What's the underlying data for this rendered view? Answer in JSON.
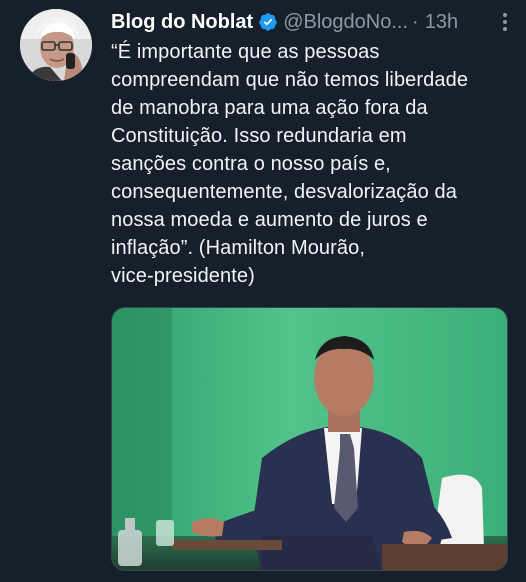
{
  "tweet": {
    "display_name": "Blog do Noblat",
    "handle": "@BlogdoNo...",
    "separator": "·",
    "timestamp": "13h",
    "text": "“É importante que as pessoas\ncompreendam que não temos liberdade\nde manobra para uma ação fora da\nConstituição. Isso redundaria em\nsanções contra o nosso país e,\nconsequentemente, desvalorização da\nnossa moeda e aumento de juros e\ninflação”. (Hamilton Mourão,\nvice-presidente)",
    "verified_icon": "verified-badge-icon",
    "more_icon": "more-vertical-icon"
  },
  "colors": {
    "background": "#15202b",
    "secondary_text": "#8b98a5",
    "verified": "#1d9bf0"
  }
}
